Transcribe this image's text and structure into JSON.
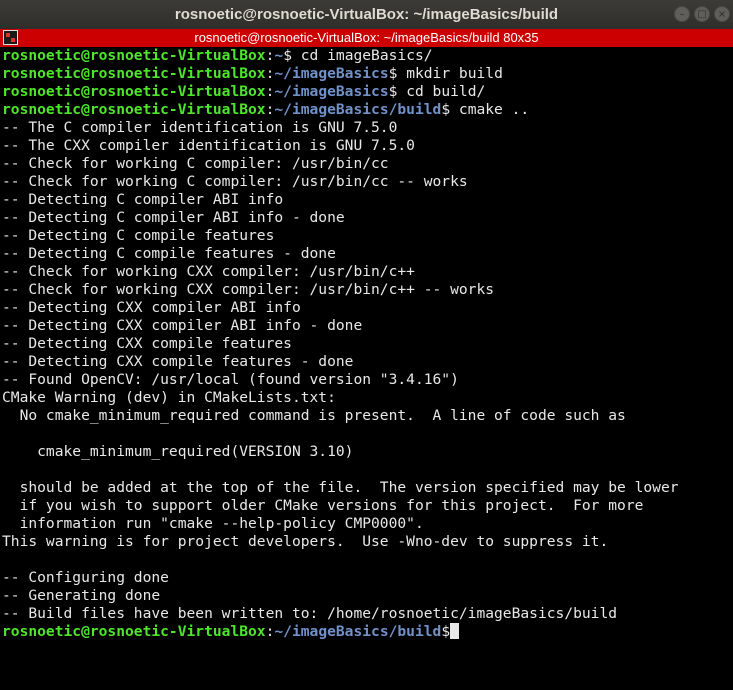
{
  "window": {
    "title": "rosnoetic@rosnoetic-VirtualBox: ~/imageBasics/build",
    "minimize_glyph": "–",
    "maximize_glyph": "□",
    "close_glyph": "×"
  },
  "tab": {
    "title": "rosnoetic@rosnoetic-VirtualBox: ~/imageBasics/build 80x35"
  },
  "colors": {
    "terminal_bg": "#000000",
    "terminal_fg": "#e8e8e8",
    "prompt_user": "#4ee62a",
    "prompt_path": "#7191c9",
    "tab_bar": "#cc0000"
  },
  "terminal": {
    "lines": [
      {
        "type": "prompt",
        "user": "rosnoetic@rosnoetic-VirtualBox",
        "sep": ":",
        "path": "~",
        "symbol": "$ ",
        "cmd": "cd imageBasics/"
      },
      {
        "type": "prompt",
        "user": "rosnoetic@rosnoetic-VirtualBox",
        "sep": ":",
        "path": "~/imageBasics",
        "symbol": "$ ",
        "cmd": "mkdir build"
      },
      {
        "type": "prompt",
        "user": "rosnoetic@rosnoetic-VirtualBox",
        "sep": ":",
        "path": "~/imageBasics",
        "symbol": "$ ",
        "cmd": "cd build/"
      },
      {
        "type": "prompt",
        "user": "rosnoetic@rosnoetic-VirtualBox",
        "sep": ":",
        "path": "~/imageBasics/build",
        "symbol": "$ ",
        "cmd": "cmake .."
      },
      {
        "type": "output",
        "text": "-- The C compiler identification is GNU 7.5.0"
      },
      {
        "type": "output",
        "text": "-- The CXX compiler identification is GNU 7.5.0"
      },
      {
        "type": "output",
        "text": "-- Check for working C compiler: /usr/bin/cc"
      },
      {
        "type": "output",
        "text": "-- Check for working C compiler: /usr/bin/cc -- works"
      },
      {
        "type": "output",
        "text": "-- Detecting C compiler ABI info"
      },
      {
        "type": "output",
        "text": "-- Detecting C compiler ABI info - done"
      },
      {
        "type": "output",
        "text": "-- Detecting C compile features"
      },
      {
        "type": "output",
        "text": "-- Detecting C compile features - done"
      },
      {
        "type": "output",
        "text": "-- Check for working CXX compiler: /usr/bin/c++"
      },
      {
        "type": "output",
        "text": "-- Check for working CXX compiler: /usr/bin/c++ -- works"
      },
      {
        "type": "output",
        "text": "-- Detecting CXX compiler ABI info"
      },
      {
        "type": "output",
        "text": "-- Detecting CXX compiler ABI info - done"
      },
      {
        "type": "output",
        "text": "-- Detecting CXX compile features"
      },
      {
        "type": "output",
        "text": "-- Detecting CXX compile features - done"
      },
      {
        "type": "output",
        "text": "-- Found OpenCV: /usr/local (found version \"3.4.16\")"
      },
      {
        "type": "output",
        "text": "CMake Warning (dev) in CMakeLists.txt:"
      },
      {
        "type": "output",
        "text": "  No cmake_minimum_required command is present.  A line of code such as"
      },
      {
        "type": "output",
        "text": ""
      },
      {
        "type": "output",
        "text": "    cmake_minimum_required(VERSION 3.10)"
      },
      {
        "type": "output",
        "text": ""
      },
      {
        "type": "output",
        "text": "  should be added at the top of the file.  The version specified may be lower"
      },
      {
        "type": "output",
        "text": "  if you wish to support older CMake versions for this project.  For more"
      },
      {
        "type": "output",
        "text": "  information run \"cmake --help-policy CMP0000\"."
      },
      {
        "type": "output",
        "text": "This warning is for project developers.  Use -Wno-dev to suppress it."
      },
      {
        "type": "output",
        "text": ""
      },
      {
        "type": "output",
        "text": "-- Configuring done"
      },
      {
        "type": "output",
        "text": "-- Generating done"
      },
      {
        "type": "output",
        "text": "-- Build files have been written to: /home/rosnoetic/imageBasics/build"
      },
      {
        "type": "prompt",
        "user": "rosnoetic@rosnoetic-VirtualBox",
        "sep": ":",
        "path": "~/imageBasics/build",
        "symbol": "$",
        "cmd": "",
        "cursor": true
      }
    ]
  }
}
